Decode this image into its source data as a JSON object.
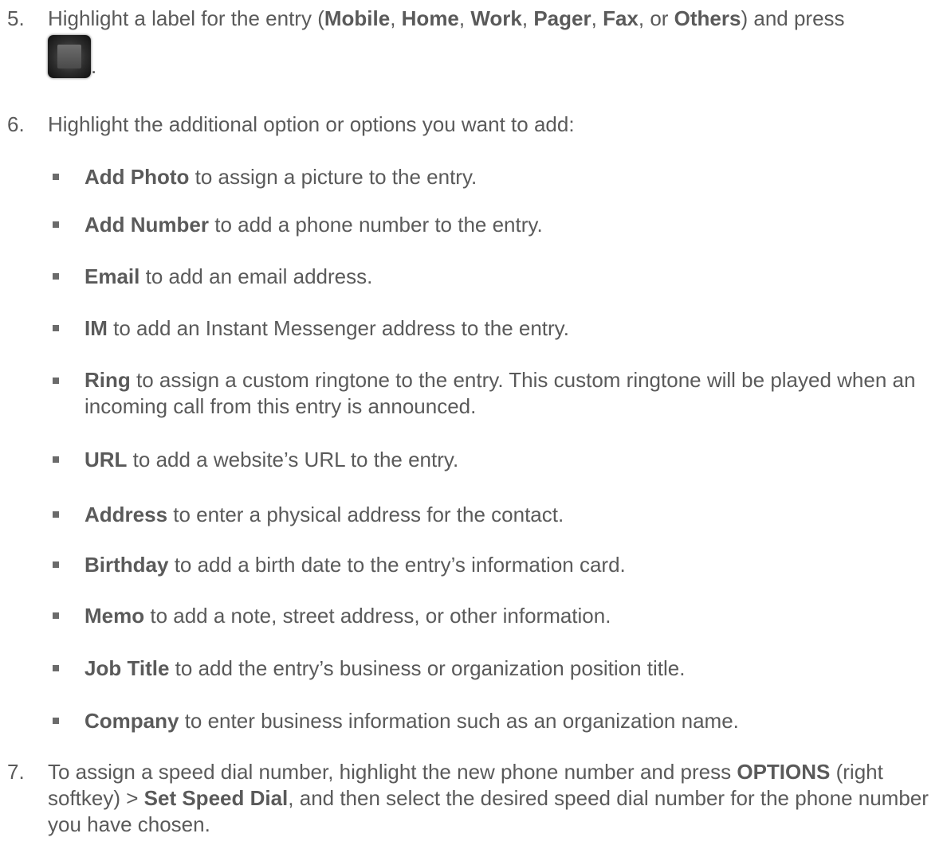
{
  "step5": {
    "number": "5.",
    "prefix": "Highlight a label for the entry (",
    "labels": [
      "Mobile",
      "Home",
      "Work",
      "Pager",
      "Fax",
      "Others"
    ],
    "sep": ", ",
    "or": ", or ",
    "suffix": ") and press",
    "after_icon": ".",
    "icon": "center-key-icon"
  },
  "step6": {
    "number": "6.",
    "text": "Highlight the additional option or options you want to add:"
  },
  "options": [
    {
      "term": "Add Photo",
      "desc": " to assign a picture to the entry."
    },
    {
      "term": "Add Number",
      "desc": " to add a phone number to the entry."
    },
    {
      "term": "Email",
      "desc": " to add an email address."
    },
    {
      "term": "IM",
      "desc": " to add an Instant Messenger address to the entry."
    },
    {
      "term": "Ring",
      "desc": " to assign a custom ringtone to the entry. This custom ringtone will be played when an incoming call from this entry is announced."
    },
    {
      "term": "URL",
      "desc": " to add a website’s URL to the entry."
    },
    {
      "term": "Address",
      "desc": " to enter a physical address for the contact."
    },
    {
      "term": "Birthday",
      "desc": " to add a birth date to the entry’s information card."
    },
    {
      "term": "Memo",
      "desc": " to add a note, street address, or other information."
    },
    {
      "term": "Job Title",
      "desc": " to add the entry’s business or organization position title."
    },
    {
      "term": "Company",
      "desc": " to enter business information such as an organization name."
    }
  ],
  "step7": {
    "number": "7.",
    "part1": "To assign a speed dial number, highlight the new phone number and press ",
    "options_key": "OPTIONS",
    "part2": " (right softkey) > ",
    "set_speed_dial": "Set Speed Dial",
    "part3": ", and then select the desired speed dial number for the phone number you have chosen."
  }
}
